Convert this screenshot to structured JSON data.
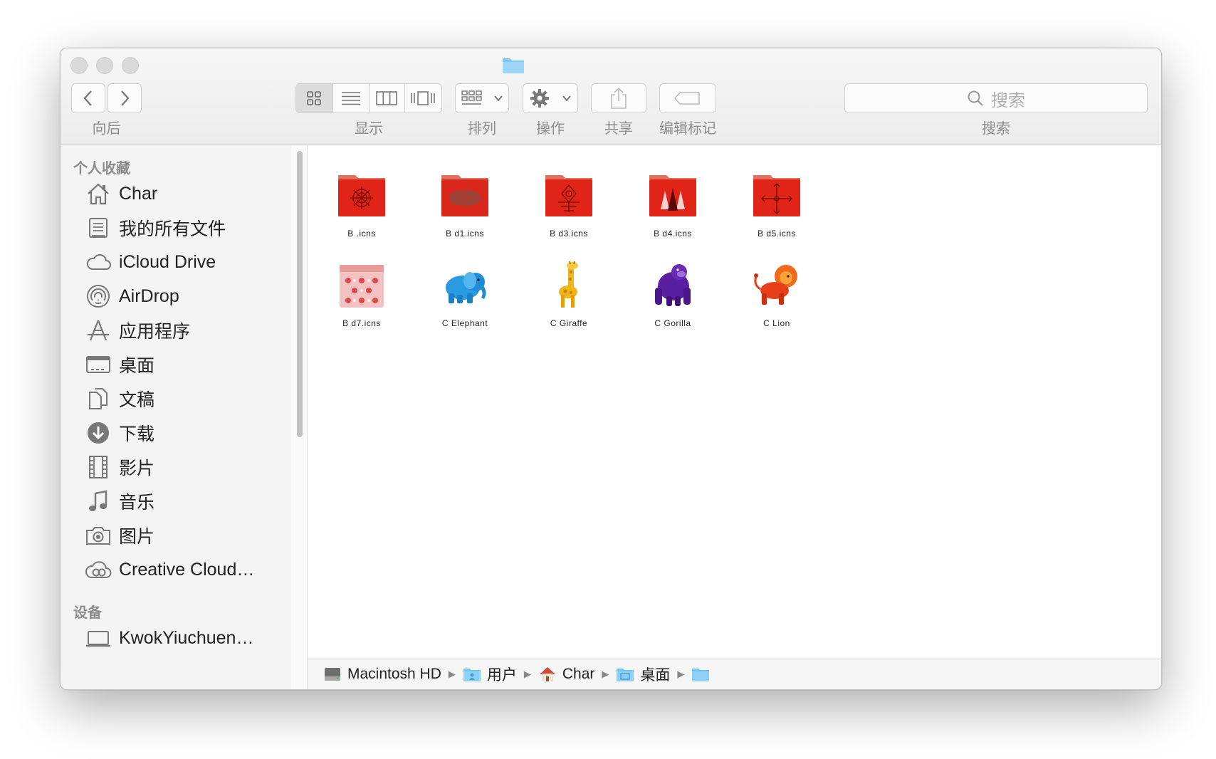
{
  "toolbar": {
    "nav_label": "向后",
    "view_label": "显示",
    "arrange_label": "排列",
    "action_label": "操作",
    "share_label": "共享",
    "tags_label": "编辑标记",
    "search_label": "搜索",
    "search_placeholder": "搜索"
  },
  "sidebar": {
    "favorites_header": "个人收藏",
    "items": [
      {
        "label": "Char",
        "icon": "home-icon"
      },
      {
        "label": "我的所有文件",
        "icon": "all-files-icon"
      },
      {
        "label": "iCloud Drive",
        "icon": "cloud-icon"
      },
      {
        "label": "AirDrop",
        "icon": "airdrop-icon"
      },
      {
        "label": "应用程序",
        "icon": "applications-icon"
      },
      {
        "label": "桌面",
        "icon": "desktop-icon"
      },
      {
        "label": "文稿",
        "icon": "documents-icon"
      },
      {
        "label": "下载",
        "icon": "download-icon"
      },
      {
        "label": "影片",
        "icon": "film-icon"
      },
      {
        "label": "音乐",
        "icon": "music-icon"
      },
      {
        "label": "图片",
        "icon": "camera-icon"
      },
      {
        "label": "Creative Cloud…",
        "icon": "creative-cloud-icon"
      }
    ],
    "devices_header": "设备",
    "devices": [
      {
        "label": "KwokYiuchuen…",
        "icon": "laptop-icon"
      }
    ]
  },
  "files": [
    {
      "name": "B .icns",
      "kind": "red-folder",
      "pattern": "medallion"
    },
    {
      "name": "B d1.icns",
      "kind": "red-folder",
      "pattern": "lace"
    },
    {
      "name": "B d3.icns",
      "kind": "red-folder",
      "pattern": "ornament"
    },
    {
      "name": "B d4.icns",
      "kind": "red-folder",
      "pattern": "trees"
    },
    {
      "name": "B d5.icns",
      "kind": "red-folder",
      "pattern": "cross"
    },
    {
      "name": "B d7.icns",
      "kind": "pink-box",
      "pattern": "floral"
    },
    {
      "name": "C Elephant",
      "kind": "animal",
      "animal": "elephant",
      "color": "#2a9be3"
    },
    {
      "name": "C Giraffe",
      "kind": "animal",
      "animal": "giraffe",
      "color": "#f2b41c"
    },
    {
      "name": "C Gorilla",
      "kind": "animal",
      "animal": "gorilla",
      "color": "#5a1fa0"
    },
    {
      "name": "C Lion",
      "kind": "animal",
      "animal": "lion",
      "color": "#e8401a"
    }
  ],
  "pathbar": [
    {
      "label": "Macintosh HD",
      "icon": "hard-drive-icon"
    },
    {
      "label": "用户",
      "icon": "users-folder-icon"
    },
    {
      "label": "Char",
      "icon": "home-icon"
    },
    {
      "label": "桌面",
      "icon": "desktop-folder-icon"
    },
    {
      "label": "",
      "icon": "folder-icon"
    }
  ],
  "colors": {
    "folder_red": "#e02418",
    "folder_blue": "#76c6f4",
    "accent_gray": "#8d8d8d"
  }
}
